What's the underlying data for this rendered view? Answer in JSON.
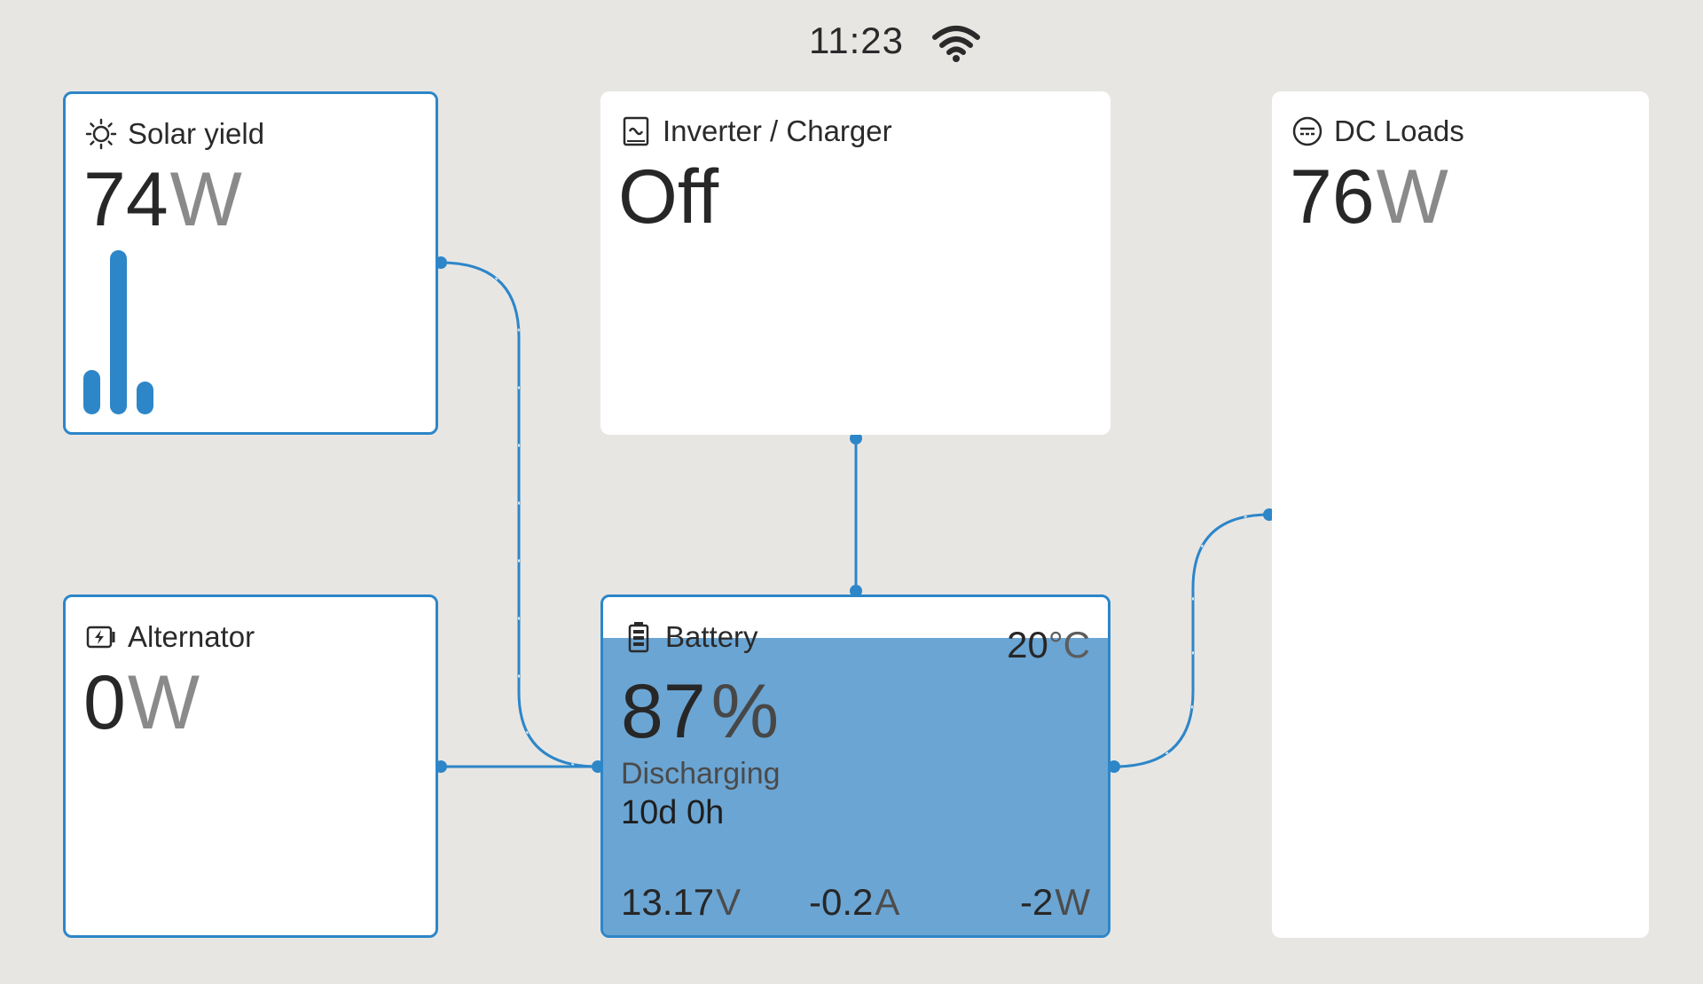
{
  "status": {
    "time": "11:23",
    "wifi_icon": "wifi-icon"
  },
  "solar": {
    "title": "Solar yield",
    "value": "74",
    "unit": "W",
    "icon": "sun-icon",
    "history_fractions": [
      0.27,
      1.0,
      0.2
    ]
  },
  "inverter": {
    "title": "Inverter / Charger",
    "value": "Off",
    "icon": "inverter-icon"
  },
  "dc_loads": {
    "title": "DC Loads",
    "value": "76",
    "unit": "W",
    "icon": "dc-loads-icon"
  },
  "alternator": {
    "title": "Alternator",
    "value": "0",
    "unit": "W",
    "icon": "alternator-icon"
  },
  "battery": {
    "title": "Battery",
    "icon": "battery-icon",
    "soc_value": "87",
    "soc_unit": "%",
    "soc_fraction": 0.87,
    "temperature_value": "20",
    "temperature_unit": "°C",
    "state": "Discharging",
    "time_to_go": "10d 0h",
    "voltage_value": "13.17",
    "voltage_unit": "V",
    "current_value": "-0.2",
    "current_unit": "A",
    "power_value": "-2",
    "power_unit": "W"
  },
  "colors": {
    "accent": "#2d86c8",
    "battery_fill": "#6ba5d3",
    "background": "#e8e6e3"
  }
}
